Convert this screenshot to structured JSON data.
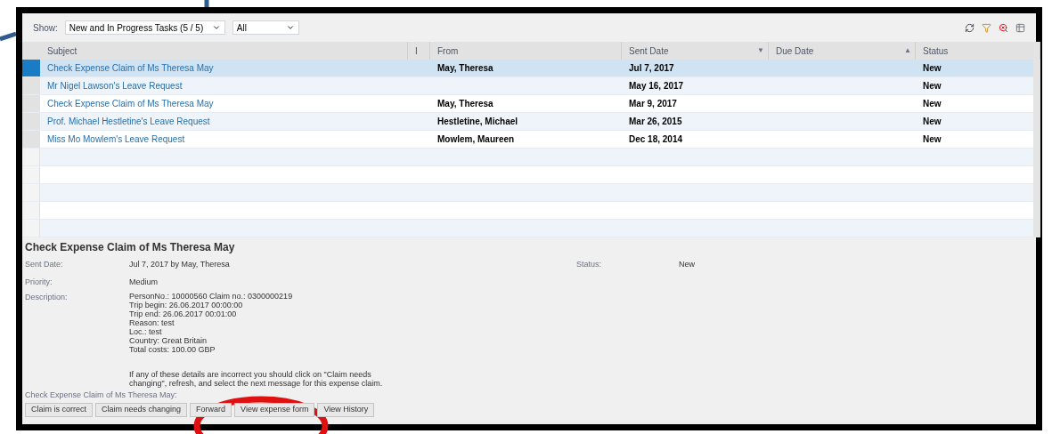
{
  "toolbar": {
    "show_label": "Show:",
    "task_filter": "New and In Progress Tasks  (5 / 5)",
    "scope_filter": "All"
  },
  "table": {
    "columns": [
      {
        "label": "Subject"
      },
      {
        "label": "I"
      },
      {
        "label": "From"
      },
      {
        "label": "Sent Date",
        "sort_mark": "▼"
      },
      {
        "label": "Due Date",
        "sort_mark": "▲"
      },
      {
        "label": "Status"
      }
    ],
    "rows": [
      {
        "selected": true,
        "subject": "Check Expense Claim of Ms Theresa May",
        "from": "May, Theresa",
        "sent_date": "Jul 7, 2017",
        "status": "New"
      },
      {
        "selected": false,
        "subject": "Mr Nigel Lawson's Leave Request",
        "sent_date": "May 16, 2017",
        "status": "New"
      },
      {
        "selected": false,
        "subject": "Check Expense Claim of Ms Theresa May",
        "from": "May, Theresa",
        "sent_date": "Mar 9, 2017",
        "status": "New"
      },
      {
        "selected": false,
        "subject": "Prof. Michael Hestletine's Leave Request",
        "from": "Hestletine, Michael",
        "sent_date": "Mar 26, 2015",
        "status": "New"
      },
      {
        "selected": false,
        "subject": "Miss Mo Mowlem's Leave Request",
        "from": "Mowlem, Maureen",
        "sent_date": "Dec 18, 2014",
        "status": "New"
      }
    ]
  },
  "details": {
    "title": "Check Expense Claim of Ms Theresa May",
    "sent_date_label": "Sent Date:",
    "sent_date": "Jul 7, 2017 by May, Theresa",
    "status_label": "Status:",
    "status": "New",
    "priority_label": "Priority:",
    "priority": "Medium",
    "description_label": "Description:",
    "description_lines": [
      "PersonNo.: 10000560 Claim no.: 0300000219",
      "Trip begin: 26.06.2017 00:00:00",
      "Trip end: 26.06.2017 00:01:00",
      "Reason: test",
      "Loc.: test",
      "Country: Great Britain",
      "Total costs: 100.00 GBP"
    ],
    "note": "If any of these details are incorrect you should click on \"Claim needs changing\", refresh, and select the next message for this expense claim.",
    "actions_label": "Check Expense Claim of Ms Theresa May:",
    "buttons": [
      "Claim is correct",
      "Claim needs changing",
      "Forward",
      "View expense form",
      "View History"
    ]
  }
}
